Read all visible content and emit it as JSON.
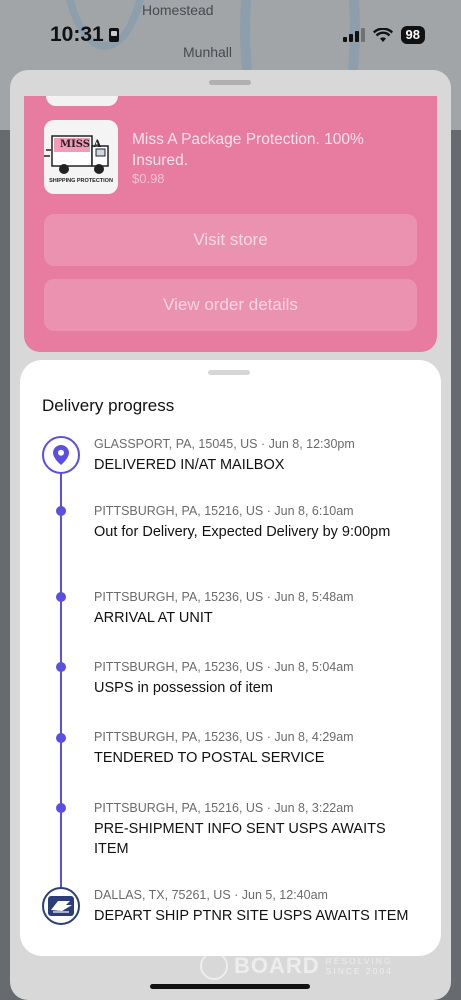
{
  "status_bar": {
    "time": "10:31",
    "battery": "98"
  },
  "map": {
    "labels": [
      "Homestead",
      "Munhall"
    ]
  },
  "order_card": {
    "product_title": "Miss A Package Protection. 100% Insured.",
    "product_price": "$0.98",
    "thumb_brand": "MISS A",
    "thumb_caption": "SHIPPING PROTECTION",
    "visit_store_label": "Visit store",
    "view_order_label": "View order details",
    "background_color": "#e87ba0"
  },
  "delivery": {
    "title": "Delivery progress",
    "accent_color": "#5b4fe0",
    "events": [
      {
        "meta": "GLASSPORT, PA, 15045, US · Jun 8, 12:30pm",
        "desc": "DELIVERED IN/AT MAILBOX",
        "icon": "location-pin-icon"
      },
      {
        "meta": "PITTSBURGH, PA, 15216, US · Jun 8, 6:10am",
        "desc": "Out for Delivery, Expected Delivery by 9:00pm",
        "icon": "dot"
      },
      {
        "meta": "PITTSBURGH, PA, 15236, US · Jun 8, 5:48am",
        "desc": "ARRIVAL AT UNIT",
        "icon": "dot"
      },
      {
        "meta": "PITTSBURGH, PA, 15236, US · Jun 8, 5:04am",
        "desc": "USPS in possession of item",
        "icon": "dot"
      },
      {
        "meta": "PITTSBURGH, PA, 15236, US · Jun 8, 4:29am",
        "desc": "TENDERED TO POSTAL SERVICE",
        "icon": "dot"
      },
      {
        "meta": "PITTSBURGH, PA, 15216, US · Jun 8, 3:22am",
        "desc": "PRE-SHIPMENT INFO SENT USPS AWAITS ITEM",
        "icon": "dot"
      },
      {
        "meta": "DALLAS, TX, 75261, US · Jun 5, 12:40am",
        "desc": "DEPART SHIP PTNR SITE USPS AWAITS ITEM",
        "icon": "usps-eagle-icon"
      }
    ]
  },
  "watermark": {
    "main": "BOARD",
    "sub1": "RESOLVING",
    "sub2": "SINCE 2004"
  }
}
